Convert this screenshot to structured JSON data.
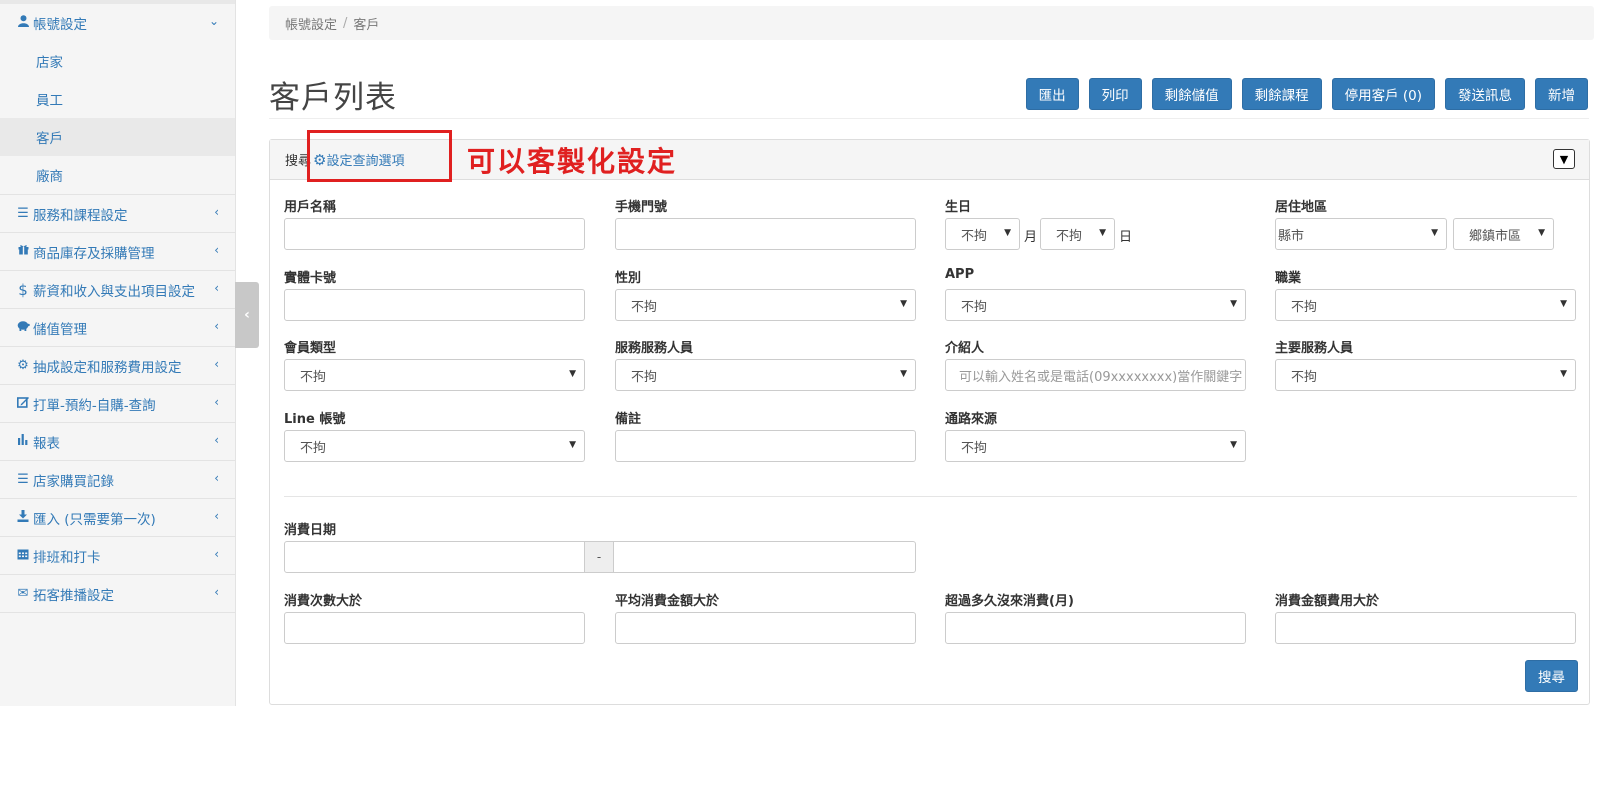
{
  "sidebar": {
    "account_settings": "帳號設定",
    "sub_items": [
      "店家",
      "員工",
      "客戶",
      "廠商"
    ],
    "items": [
      {
        "label": "服務和課程設定",
        "icon": "list-icon"
      },
      {
        "label": "商品庫存及採購管理",
        "icon": "gift-icon"
      },
      {
        "label": "薪資和收入與支出項目設定",
        "icon": "dollar-icon"
      },
      {
        "label": "儲值管理",
        "icon": "piggy-bank-icon"
      },
      {
        "label": "抽成設定和服務費用設定",
        "icon": "gear-icon"
      },
      {
        "label": "打單-預約-自購-查詢",
        "icon": "edit-icon"
      },
      {
        "label": "報表",
        "icon": "bar-chart-icon"
      },
      {
        "label": "店家購買記錄",
        "icon": "list-icon"
      },
      {
        "label": "匯入 (只需要第一次)",
        "icon": "download-icon"
      },
      {
        "label": "排班和打卡",
        "icon": "calendar-icon"
      },
      {
        "label": "拓客推播設定",
        "icon": "envelope-icon"
      }
    ]
  },
  "breadcrumb": {
    "parent": "帳號設定",
    "sep": "/",
    "current": "客戶"
  },
  "page_title": "客戶列表",
  "toolbar": {
    "export": "匯出",
    "print": "列印",
    "remaining_value": "剩餘儲值",
    "remaining_course": "剩餘課程",
    "disabled_customers": "停用客戶 (0)",
    "send_message": "發送訊息",
    "add": "新增"
  },
  "panel": {
    "search_label": "搜尋",
    "settings_link": "設定查詢選項",
    "annotation": "可以客製化設定"
  },
  "fields": {
    "username": "用戶名稱",
    "phone": "手機門號",
    "birthday": "生日",
    "birth_month_value": "不拘",
    "month_unit": "月",
    "birth_day_value": "不拘",
    "day_unit": "日",
    "region": "居住地區",
    "county_value": "縣市",
    "district_value": "鄉鎮市區",
    "card_no": "實體卡號",
    "gender": "性別",
    "gender_value": "不拘",
    "app": "APP",
    "app_value": "不拘",
    "occupation": "職業",
    "occupation_value": "不拘",
    "member_type": "會員類型",
    "member_type_value": "不拘",
    "service_staff": "服務服務人員",
    "service_staff_value": "不拘",
    "referrer": "介紹人",
    "referrer_placeholder": "可以輸入姓名或是電話(09xxxxxxxx)當作關鍵字",
    "main_staff": "主要服務人員",
    "main_staff_value": "不拘",
    "line_account": "Line 帳號",
    "line_value": "不拘",
    "note": "備註",
    "channel": "通路來源",
    "channel_value": "不拘",
    "consume_date": "消費日期",
    "date_sep": "-",
    "consume_count": "消費次數大於",
    "avg_amount": "平均消費金額大於",
    "months_absent": "超過多久沒來消費(月)",
    "total_amount": "消費金額費用大於",
    "search_button": "搜尋"
  }
}
